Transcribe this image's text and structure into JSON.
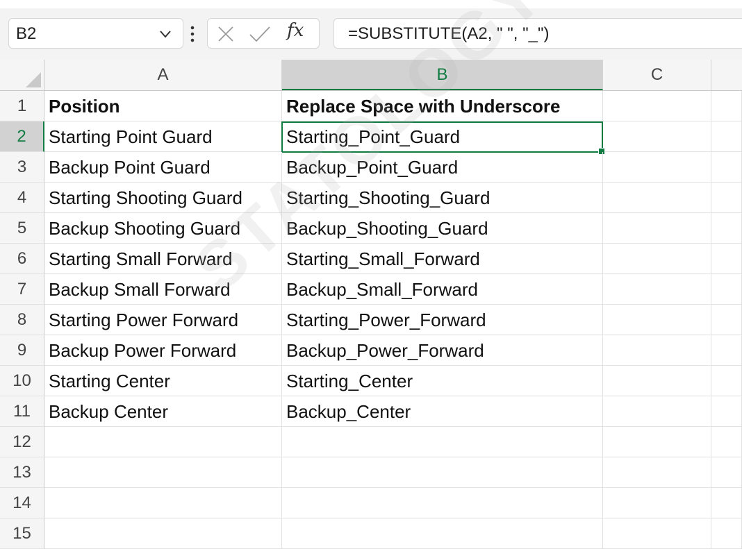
{
  "formula_bar": {
    "name_box": "B2",
    "formula": "=SUBSTITUTE(A2, \" \", \"_\")",
    "fx_label": "fx",
    "icons": [
      "chevron-down-icon",
      "more-vertical-icon",
      "cancel-icon",
      "enter-check-icon",
      "function-icon"
    ]
  },
  "columns": [
    "A",
    "B",
    "C"
  ],
  "selected_column": "B",
  "selected_row": "2",
  "rows": [
    {
      "num": "1",
      "a": "Position",
      "b": "Replace Space with Underscore",
      "bold": true
    },
    {
      "num": "2",
      "a": "Starting Point Guard",
      "b": "Starting_Point_Guard"
    },
    {
      "num": "3",
      "a": "Backup Point Guard",
      "b": "Backup_Point_Guard"
    },
    {
      "num": "4",
      "a": "Starting Shooting Guard",
      "b": "Starting_Shooting_Guard"
    },
    {
      "num": "5",
      "a": "Backup Shooting Guard",
      "b": "Backup_Shooting_Guard"
    },
    {
      "num": "6",
      "a": "Starting Small Forward",
      "b": "Starting_Small_Forward"
    },
    {
      "num": "7",
      "a": "Backup Small Forward",
      "b": "Backup_Small_Forward"
    },
    {
      "num": "8",
      "a": "Starting Power Forward",
      "b": "Starting_Power_Forward"
    },
    {
      "num": "9",
      "a": "Backup Power Forward",
      "b": "Backup_Power_Forward"
    },
    {
      "num": "10",
      "a": "Starting Center",
      "b": "Starting_Center"
    },
    {
      "num": "11",
      "a": "Backup Center",
      "b": "Backup_Center"
    },
    {
      "num": "12",
      "a": "",
      "b": ""
    },
    {
      "num": "13",
      "a": "",
      "b": ""
    },
    {
      "num": "14",
      "a": "",
      "b": ""
    },
    {
      "num": "15",
      "a": "",
      "b": ""
    }
  ],
  "watermark": "STATOLOGY",
  "colors": {
    "accent": "#107c41",
    "header_bg": "#f5f5f5",
    "selected_header_bg": "#d2d2d2"
  }
}
